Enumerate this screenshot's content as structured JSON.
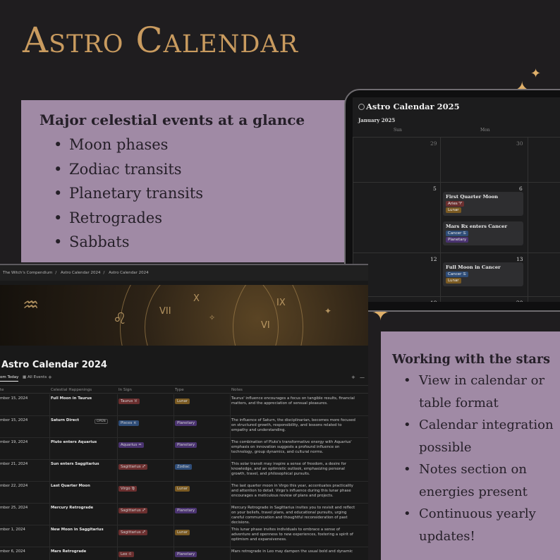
{
  "hero": {
    "title": "Astro Calendar"
  },
  "features_card": {
    "heading": "Major celestial events at a glance",
    "items": [
      "Moon phases",
      "Zodiac transits",
      "Planetary transits",
      "Retrogrades",
      "Sabbats"
    ]
  },
  "working_card": {
    "heading": "Working with the stars",
    "items": [
      "View in calendar or table format",
      "Calendar integration possible",
      "Notes section on energies present",
      "Continuous yearly updates!"
    ]
  },
  "calendar": {
    "title": "Astro Calendar 2025",
    "month": "January 2025",
    "weekdays": [
      "Sun",
      "Mon"
    ],
    "rows": [
      {
        "sun": "29",
        "mon": "30"
      },
      {
        "sun": "5",
        "mon": "6"
      },
      {
        "sun": "12",
        "mon": "13"
      },
      {
        "sun": "19",
        "mon": "20"
      }
    ],
    "events": [
      {
        "title": "First Quarter Moon",
        "tags": [
          {
            "label": "Aries ♈",
            "kind": "aries"
          },
          {
            "label": "Lunar",
            "kind": "lunar"
          }
        ]
      },
      {
        "title": "Mars Rx enters Cancer",
        "tags": [
          {
            "label": "Cancer ♋",
            "kind": "cancer"
          },
          {
            "label": "Planetary",
            "kind": "planetary"
          }
        ]
      },
      {
        "title": "Full Moon in Cancer",
        "tags": [
          {
            "label": "Cancer ♋",
            "kind": "cancer"
          },
          {
            "label": "Lunar",
            "kind": "lunar"
          }
        ]
      }
    ]
  },
  "table_app": {
    "breadcrumbs": [
      "The Witch's Compendium",
      "Astro Calendar 2024",
      "Astro Calendar 2024"
    ],
    "title": "Astro Calendar 2024",
    "views": [
      "om Today",
      "All Events"
    ],
    "add_view": "+",
    "columns": [
      "te",
      "Celestial Happenings",
      "In Sign",
      "Type",
      "Notes"
    ],
    "open_label": "OPEN",
    "rows": [
      {
        "date": "mber 15, 2024",
        "event": "Full Moon in Taurus",
        "sign": "Taurus ♉",
        "sign_kind": "taurus",
        "type": "Lunar",
        "type_kind": "lunar",
        "note": "Taurus' influence encourages a focus on tangible results, financial matters, and the appreciation of sensual pleasures."
      },
      {
        "date": "mber 15, 2024",
        "event": "Saturn Direct",
        "sign": "Pisces ♓",
        "sign_kind": "pisces",
        "type": "Planetary",
        "type_kind": "planetary",
        "note": "The influence of Saturn, the disciplinarian, becomes more focused on structured growth, responsibility, and lessons related to empathy and understanding."
      },
      {
        "date": "mber 19, 2024",
        "event": "Pluto enters Aquarius",
        "sign": "Aquarius ♒",
        "sign_kind": "aquarius",
        "type": "Planetary",
        "type_kind": "planetary",
        "note": "The combination of Pluto's transformative energy with Aquarius' emphasis on innovation suggests a profound influence on technology, group dynamics, and cultural norms."
      },
      {
        "date": "mber 21, 2024",
        "event": "Sun enters Saggitarius",
        "sign": "Sagittarius ♐",
        "sign_kind": "sag",
        "type": "Zodiac",
        "type_kind": "zodiac",
        "note": "This solar transit may inspire a sense of freedom, a desire for knowledge, and an optimistic outlook, emphasizing personal growth, travel, and philosophical pursuits."
      },
      {
        "date": "mber 22, 2024",
        "event": "Last Quarter Moon",
        "sign": "Virgo ♍",
        "sign_kind": "virgo",
        "type": "Lunar",
        "type_kind": "lunar",
        "note": "The last quarter moon in Virgo this year, accentuates practicality and attention to detail. Virgo's influence during this lunar phase encourages a meticulous review of plans and projects."
      },
      {
        "date": "mber 25, 2024",
        "event": "Mercury Retrograde",
        "sign": "Sagittarius ♐",
        "sign_kind": "sag",
        "type": "Planetary",
        "type_kind": "planetary",
        "note": "Mercury Retrograde in Sagittarius invites you to revisit and reflect on your beliefs, travel plans, and educational pursuits, urging careful communication and thoughtful reconsideration of past decisions."
      },
      {
        "date": "mber 1, 2024",
        "event": "New Moon in Saggitarius",
        "sign": "Sagittarius ♐",
        "sign_kind": "sag",
        "type": "Lunar",
        "type_kind": "lunar",
        "note": "This lunar phase invites individuals to embrace a sense of adventure and openness to new experiences, fostering a spirit of optimism and expansiveness."
      },
      {
        "date": "mber 6, 2024",
        "event": "Mars Retrograde",
        "sign": "Leo ♌",
        "sign_kind": "leo",
        "type": "Planetary",
        "type_kind": "planetary",
        "note": "Mars retrograde in Leo may dampen the usual bold and dynamic"
      }
    ]
  },
  "icons": {
    "sparkle": "✦",
    "calendar_logo": "moon-icon",
    "table_view": "table-icon"
  }
}
